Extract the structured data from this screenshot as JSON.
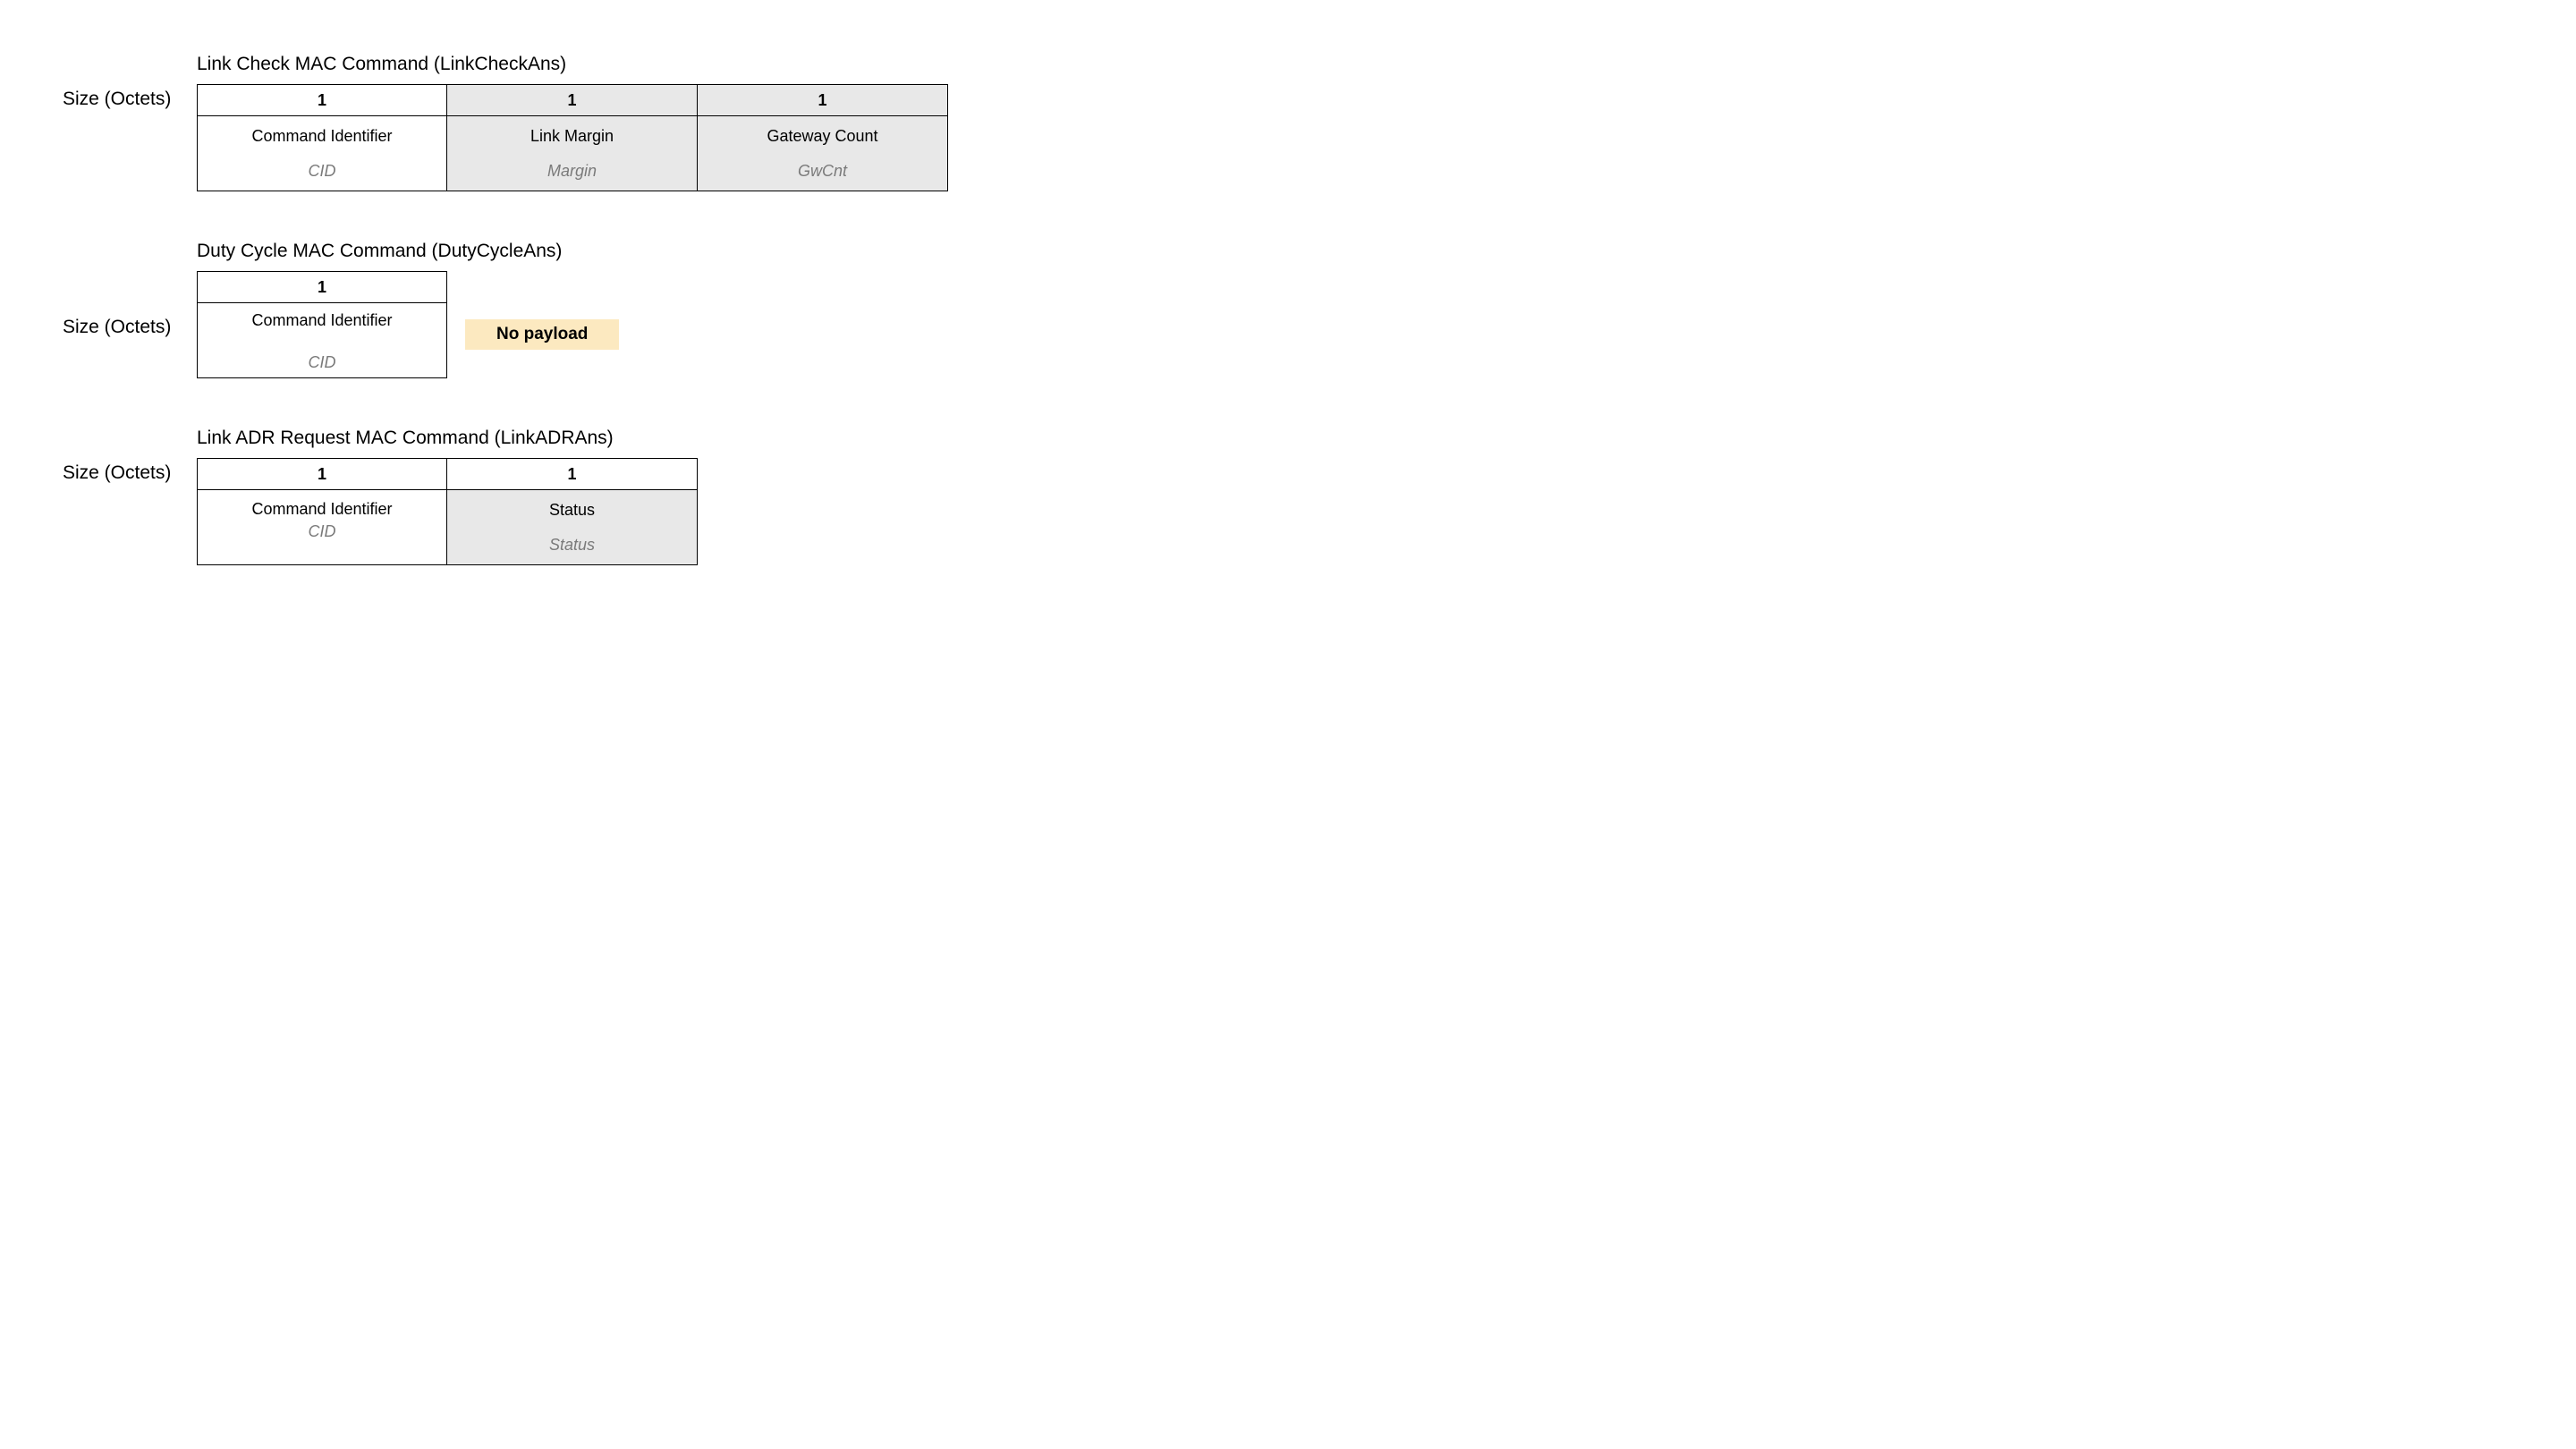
{
  "sizeLabel": "Size (Octets)",
  "sections": {
    "linkCheck": {
      "title": "Link Check MAC Command (LinkCheckAns)",
      "cols": [
        {
          "size": "1",
          "name": "Command Identifier",
          "alias": "CID",
          "shaded": false
        },
        {
          "size": "1",
          "name": "Link Margin",
          "alias": "Margin",
          "shaded": true
        },
        {
          "size": "1",
          "name": "Gateway Count",
          "alias": "GwCnt",
          "shaded": true
        }
      ]
    },
    "dutyCycle": {
      "title": "Duty Cycle MAC Command (DutyCycleAns)",
      "cols": [
        {
          "size": "1",
          "name": "Command Identifier",
          "alias": "CID",
          "shaded": false
        }
      ],
      "noPayload": "No payload"
    },
    "linkADR": {
      "title": "Link ADR Request MAC Command (LinkADRAns)",
      "cols": [
        {
          "size": "1",
          "name": "Command Identifier",
          "alias": "CID",
          "shaded": false
        },
        {
          "size": "1",
          "name": "Status",
          "alias": "Status",
          "shaded": true
        }
      ]
    }
  }
}
